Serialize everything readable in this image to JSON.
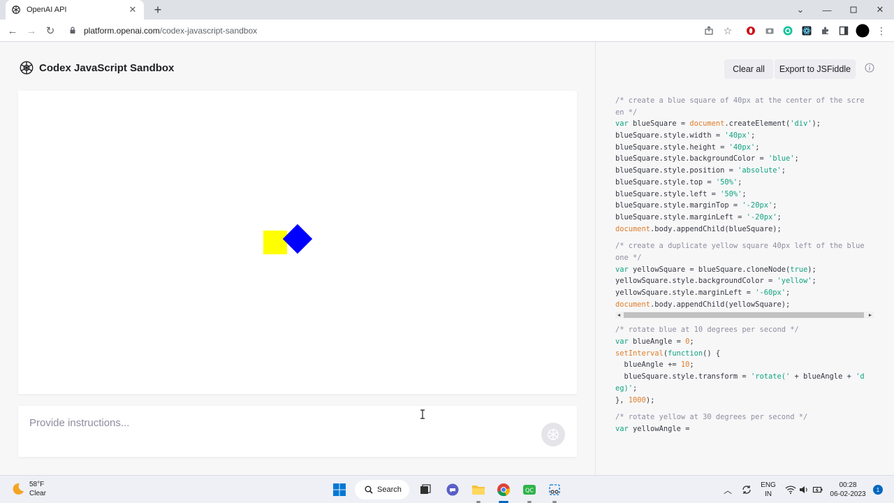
{
  "browser": {
    "tab_title": "OpenAI API",
    "url_domain": "platform.openai.com",
    "url_path": "/codex-javascript-sandbox"
  },
  "app": {
    "title": "Codex JavaScript Sandbox",
    "clear_all_label": "Clear all",
    "export_label": "Export to JSFiddle",
    "instructions_placeholder": "Provide instructions..."
  },
  "sandbox": {
    "yellow_color": "#ffff00",
    "blue_color": "#0000ff"
  },
  "code": {
    "block1": [
      "/* create a blue square of 40px at the center of the scre",
      "en */",
      "var blueSquare = document.createElement('div');",
      "blueSquare.style.width = '40px';",
      "blueSquare.style.height = '40px';",
      "blueSquare.style.backgroundColor = 'blue';",
      "blueSquare.style.position = 'absolute';",
      "blueSquare.style.top = '50%';",
      "blueSquare.style.left = '50%';",
      "blueSquare.style.marginTop = '-20px';",
      "blueSquare.style.marginLeft = '-20px';",
      "document.body.appendChild(blueSquare);"
    ],
    "block2": [
      "/* create a duplicate yellow square 40px left of the blue",
      "one */",
      "var yellowSquare = blueSquare.cloneNode(true);",
      "yellowSquare.style.backgroundColor = 'yellow';",
      "yellowSquare.style.marginLeft = '-60px';",
      "document.body.appendChild(yellowSquare);"
    ],
    "block3": [
      "/* rotate blue at 10 degrees per second */",
      "var blueAngle = 0;",
      "setInterval(function() {",
      "  blueAngle += 10;",
      "  blueSquare.style.transform = 'rotate(' + blueAngle + 'd",
      "eg)';",
      "}, 1000);"
    ],
    "block4": [
      "/* rotate yellow at 30 degrees per second */",
      "var yellowAngle ="
    ]
  },
  "taskbar": {
    "weather_temp": "58°F",
    "weather_desc": "Clear",
    "search_label": "Search",
    "lang_top": "ENG",
    "lang_bottom": "IN",
    "time": "00:28",
    "date": "06-02-2023",
    "notification_count": "1"
  },
  "colors": {
    "accent_green": "#10a37f",
    "accent_orange": "#df7e2b",
    "comment_gray": "#8e8ea0"
  }
}
